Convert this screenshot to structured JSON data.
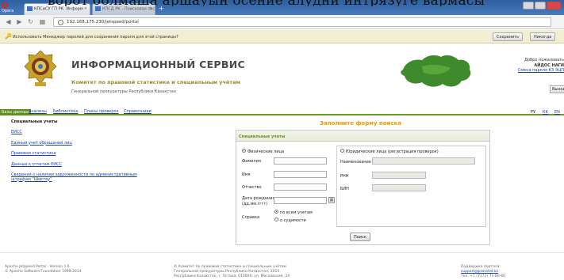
{
  "banner_text": "ворот болмаша аршауын осение алудни интрязуге вармасы",
  "browser": {
    "opera_label": "Opera",
    "tabs": [
      {
        "label": "КПСиСУ ГП РК. Информ"
      },
      {
        "label": "КПСД РК - Поисковая сис"
      }
    ],
    "url": "192.168.175.230/jetspeed/portal",
    "password_bar": {
      "message": "Использовать Менеджер паролей для сохранения пароля для этой страницы?",
      "save_label": "Сохранить",
      "never_label": "Никогда"
    }
  },
  "header": {
    "title": "ИНФОРМАЦИОННЫЙ СЕРВИС",
    "subtitle": "Комитет по правовой статистике и специальным учётам",
    "subtitle2": "Генеральной прокуратуры Республики Казахстан",
    "welcome": "Добро пожаловать",
    "user": "АЙДОС НАГИ",
    "change_password": "Смена пароля КЗ ЭЦП",
    "logout": "Выход"
  },
  "menu": {
    "items": [
      "Базы данных",
      "Анализы",
      "Библиотека",
      "Планы проверок",
      "Справочники"
    ],
    "lang": [
      "РУ",
      "КК",
      "EN"
    ]
  },
  "sidebar": {
    "heading": "Специальные учеты",
    "links": [
      "ЕИСС",
      "Единый учет обращений лиц",
      "Правовая статистика",
      "Данные к отчетам ЕИСС",
      "Сведения о наличии задолженности по административным штрафам \"Шектеу\""
    ]
  },
  "form": {
    "title": "Заполните форму поиска",
    "section": "Специальные учеты",
    "left": {
      "radio_label": "Физические лица",
      "surname": "Фамилия",
      "name": "Имя",
      "patronymic": "Отчество",
      "birthdate": "Дата рождения",
      "birthdate_hint": "(дд.мм.гггг)",
      "reference": "Справка",
      "ref_opt1": "по всем учетам",
      "ref_opt2": "о судимости"
    },
    "right": {
      "radio_label": "Юридические лица (регистрация проверок)",
      "name": "Наименование",
      "rnn": "РНН",
      "bin": "БИН"
    },
    "search_button": "Поиск"
  },
  "footer": {
    "left1": "Apache Jetspeed Portal - Version 1.6",
    "left2": "© Apache Software Foundation 1999-2014",
    "mid1": "© Комитет по правовой статистике и специальным учётам",
    "mid2": "Генеральной прокуратуры Республики Казахстан, 2014",
    "mid3": "Республика Казахстан, г. Астана, 010000, ул. Московская, 24",
    "right1": "Поддержка портала:",
    "right2": "support@pravstat.kz",
    "right3": "тел. +7 (7172) 71-80-60"
  },
  "colors": {
    "menu_green": "#5f8f1f",
    "title_gold": "#9c8a2a",
    "form_title": "#e0a000",
    "link_blue": "#1a3fae"
  }
}
